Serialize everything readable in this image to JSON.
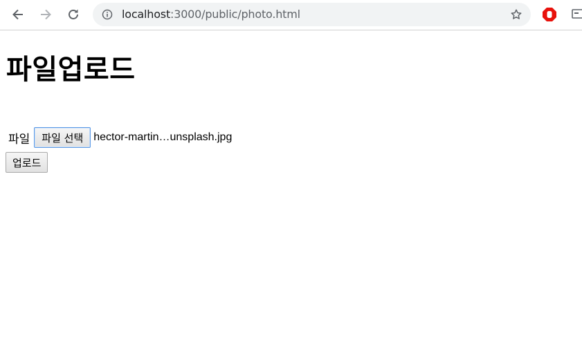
{
  "browser": {
    "url_host": "localhost",
    "url_rest": ":3000/public/photo.html",
    "icons": {
      "back": "back-arrow-icon",
      "forward": "forward-arrow-icon",
      "reload": "reload-icon",
      "info": "info-icon",
      "bookmark": "star-icon",
      "extension_1": "stop-sign-icon",
      "extension_2": "cast-icon"
    }
  },
  "page": {
    "heading": "파일업로드",
    "file_label": "파일",
    "choose_button": "파일 선택",
    "selected_file": "hector-martin…unsplash.jpg",
    "upload_button": "업로드"
  }
}
